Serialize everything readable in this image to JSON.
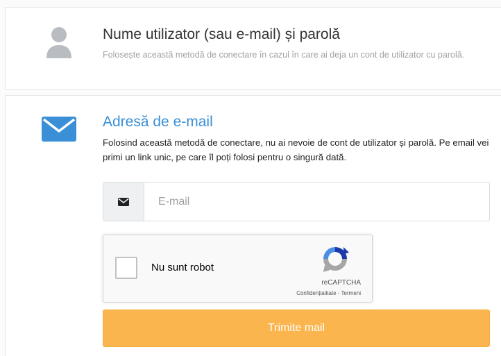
{
  "username_option": {
    "icon": "user-icon",
    "title": "Nume utilizator (sau e-mail) și parolă",
    "description": "Folosește această metodă de conectare în cazul în care ai deja un cont de utilizator cu parolă."
  },
  "email_option": {
    "icon": "envelope-icon",
    "title": "Adresă de e-mail",
    "description": "Folosind această metodă de conectare, nu ai nevoie de cont de utilizator și parolă. Pe email vei primi un link unic, pe care îl poți folosi pentru o singură dată.",
    "input": {
      "addon_icon": "envelope-icon",
      "placeholder": "E-mail",
      "value": ""
    },
    "recaptcha": {
      "label": "Nu sunt robot",
      "brand": "reCAPTCHA",
      "privacy_link": "Confidențialitate",
      "separator": " - ",
      "terms_link": "Termeni"
    },
    "submit_label": "Trimite mail"
  },
  "colors": {
    "accent_blue": "#3a8fd6",
    "submit_orange": "#fbb54f",
    "icon_gray": "#b9bdc1"
  }
}
